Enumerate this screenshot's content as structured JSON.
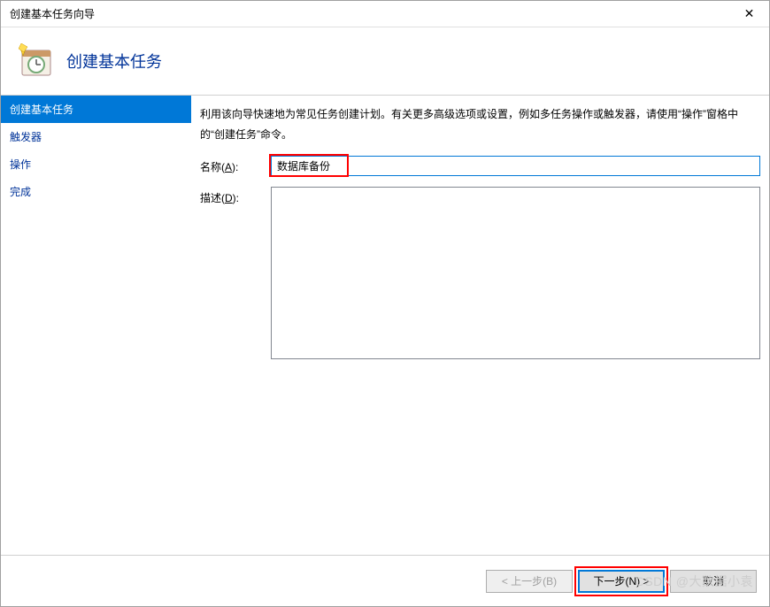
{
  "titlebar": {
    "title": "创建基本任务向导",
    "close_glyph": "✕"
  },
  "header": {
    "title": "创建基本任务"
  },
  "sidebar": {
    "items": [
      {
        "label": "创建基本任务",
        "selected": true
      },
      {
        "label": "触发器",
        "selected": false
      },
      {
        "label": "操作",
        "selected": false
      },
      {
        "label": "完成",
        "selected": false
      }
    ]
  },
  "main": {
    "intro": "利用该向导快速地为常见任务创建计划。有关更多高级选项或设置，例如多任务操作或触发器，请使用“操作”窗格中的“创建任务”命令。",
    "name_label_prefix": "名称(",
    "name_label_key": "A",
    "name_label_suffix": "):",
    "name_value": "数据库备份",
    "desc_label_prefix": "描述(",
    "desc_label_key": "D",
    "desc_label_suffix": "):",
    "desc_value": ""
  },
  "footer": {
    "back": "< 上一步(B)",
    "next": "下一步(N) >",
    "cancel": "取消"
  },
  "watermark": "CSDN @大数据小袁"
}
